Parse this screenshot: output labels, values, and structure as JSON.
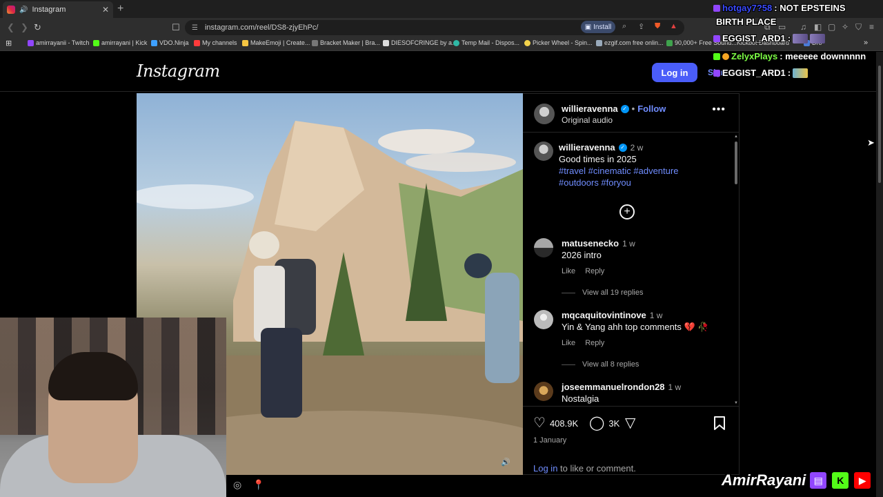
{
  "browser": {
    "tab_title": "Instagram",
    "tab_audio": "🔊",
    "url": "instagram.com/reel/DS8-zjyEhPc/",
    "install_label": "Install",
    "bookmarks": [
      "amirrayanii - Twitch",
      "amirrayani | Kick",
      "VDO.Ninja",
      "My channels",
      "MakeEmoji | Create...",
      "Bracket Maker | Bra...",
      "DIESOFCRINGE by a...",
      "Temp Mail - Dispos...",
      "Picker Wheel - Spin...",
      "ezgif.com free onlin...",
      "90,000+ Free Sound...",
      "Kickbot Dashboard",
      "Dro"
    ]
  },
  "instagram": {
    "logo": "Instagram",
    "login_button": "Log in",
    "signup_label": "Sign",
    "post": {
      "username": "willieravenna",
      "follow_label": "Follow",
      "audio_label": "Original audio",
      "caption_time": "2 w",
      "caption_text": "Good times in 2025",
      "hashtags_line1": "#travel #cinematic #adventure",
      "hashtags_line2": "#outdoors #foryou"
    },
    "comments": [
      {
        "user": "matusenecko",
        "time": "1 w",
        "text": "2026 intro",
        "like": "Like",
        "reply": "Reply",
        "view_replies": "View all 19 replies"
      },
      {
        "user": "mqcaquitovintinove",
        "time": "1 w",
        "text": "Yin & Yang ahh top comments 💔 🥀",
        "like": "Like",
        "reply": "Reply",
        "view_replies": "View all 8 replies"
      },
      {
        "user": "joseemmanuelrondon28",
        "time": "1 w",
        "text": "Nostalgia"
      }
    ],
    "likes": "408.9K",
    "comments_count": "3K",
    "date": "1 January",
    "login_prompt_link": "Log in",
    "login_prompt_rest": " to like or comment."
  },
  "stream": {
    "chat": [
      {
        "name": "hotgay7?58",
        "message": ": NOT EPSTEINS"
      },
      {
        "name": "",
        "message": "BIRTH PLACE"
      },
      {
        "name": "EGGIST_ARD1",
        "message": ":"
      },
      {
        "name": "ZelyxPlays",
        "message": ": meeeee downnnnn"
      },
      {
        "name": "EGGIST_ARD1",
        "message": ":"
      }
    ],
    "brand_name": "AmirRayani",
    "brand_icons": [
      "twitch-icon",
      "kick-icon",
      "youtube-icon"
    ]
  },
  "colors": {
    "ig_blue": "#4a5df9",
    "link_blue": "#708dff",
    "verified": "#0095f6",
    "twitch": "#9146ff",
    "kick": "#53fc18",
    "youtube": "#ff0000"
  }
}
